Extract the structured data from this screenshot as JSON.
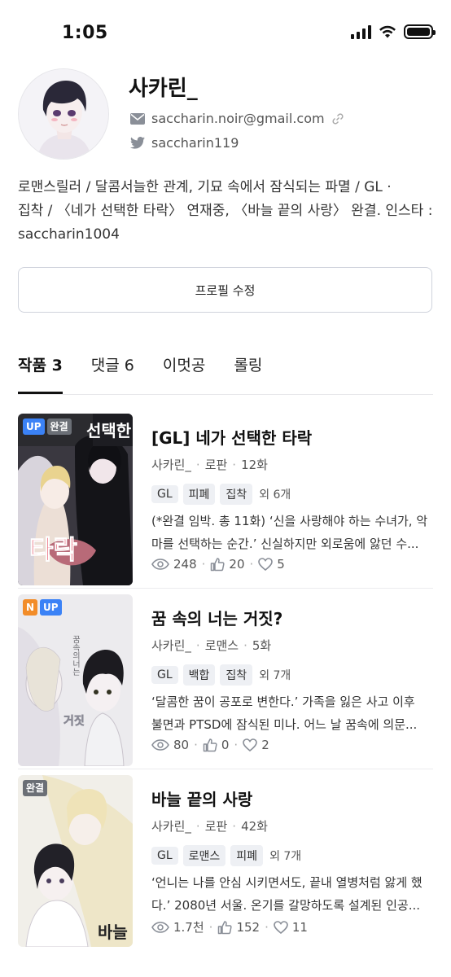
{
  "status_bar": {
    "time": "1:05"
  },
  "profile": {
    "name": "사카린_",
    "email": "saccharin.noir@gmail.com",
    "twitter": "saccharin119",
    "bio_lines": [
      "로맨스릴러 / 달콤서늘한 관계, 기묘 속에서 잠식되는 파멸 / GL ·",
      "집착 / 〈네가 선택한 타락〉 연재중, 〈바늘 끝의 사랑〉 완결. 인스타 :",
      "saccharin1004"
    ],
    "edit_label": "프로필 수정"
  },
  "tabs": [
    {
      "label": "작품 3",
      "active": true
    },
    {
      "label": "댓글 6",
      "active": false
    },
    {
      "label": "이멋공",
      "active": false
    },
    {
      "label": "롤링",
      "active": false
    }
  ],
  "works": [
    {
      "badges": [
        "UP",
        "완결"
      ],
      "cover_text": "선택한",
      "cover_text2": "타락",
      "title": "[GL] 네가 선택한 타락",
      "author": "사카린_",
      "genre": "로판",
      "episodes": "12화",
      "tags": [
        "GL",
        "피폐",
        "집착"
      ],
      "more_tags": "외 6개",
      "desc_lines": [
        "(*완결 임박. 총 11화) ‘신을 사랑해야 하는 수녀가, 악",
        "마를 선택하는 순간.’ 신실하지만 외로움에 앓던 수..."
      ],
      "views": "248",
      "likes": "20",
      "hearts": "5"
    },
    {
      "badges": [
        "N",
        "UP"
      ],
      "cover_text": "꿈속의너는",
      "cover_text2": "거짓",
      "title": "꿈 속의 너는 거짓?",
      "author": "사카린_",
      "genre": "로맨스",
      "episodes": "5화",
      "tags": [
        "GL",
        "백합",
        "집착"
      ],
      "more_tags": "외 7개",
      "desc_lines": [
        "‘달콤한 꿈이 공포로 변한다.’ 가족을 잃은 사고 이후",
        "불면과 PTSD에 잠식된 미나. 어느 날 꿈속에 의문..."
      ],
      "views": "80",
      "likes": "0",
      "hearts": "2"
    },
    {
      "badges": [
        "완결"
      ],
      "cover_text": "바늘",
      "cover_text2": "",
      "title": "바늘 끝의 사랑",
      "author": "사카린_",
      "genre": "로판",
      "episodes": "42화",
      "tags": [
        "GL",
        "로맨스",
        "피폐"
      ],
      "more_tags": "외 7개",
      "desc_lines": [
        "‘언니는 나를 안심 시키면서도, 끝내 열병처럼 앓게 했",
        "다.’ 2080년 서울. 온기를 갈망하도록 설계된 인공..."
      ],
      "views": "1.7천",
      "likes": "152",
      "hearts": "11"
    }
  ],
  "icons": {
    "mail": "mail-icon",
    "link": "link-icon",
    "twitter": "twitter-icon",
    "eye": "eye-icon",
    "thumb": "thumbs-up-icon",
    "heart": "heart-icon"
  },
  "colors": {
    "badge_up": "#3b82f6",
    "badge_done": "#6b6f76",
    "badge_new": "#f28c28",
    "cover_title_red": "#e0314b"
  }
}
